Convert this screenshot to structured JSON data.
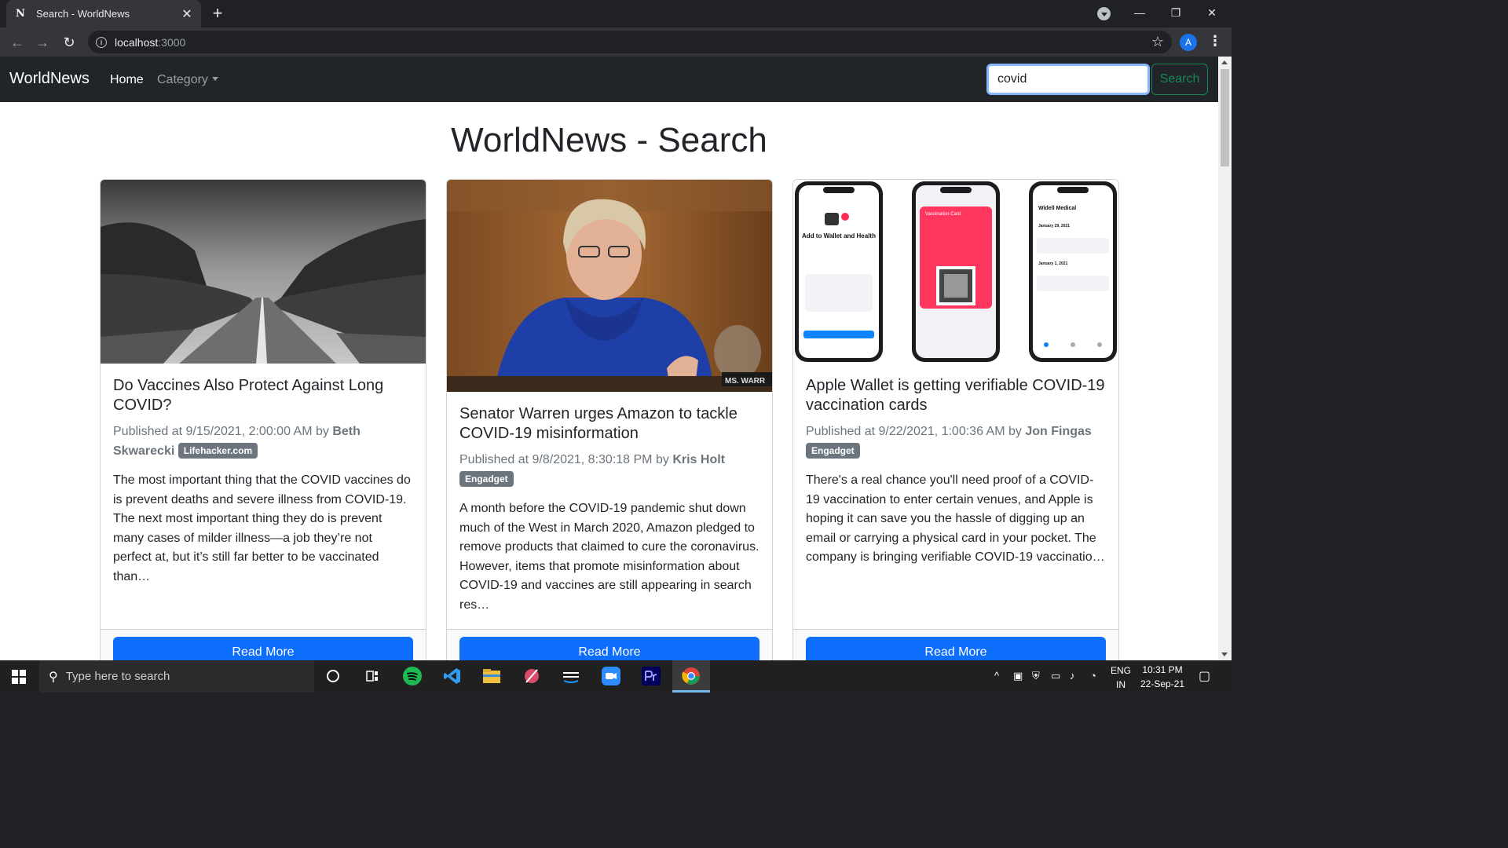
{
  "browser": {
    "tab_title": "Search - WorldNews",
    "favicon": "N",
    "url_host": "localhost",
    "url_port": ":3000",
    "profile_initial": "A"
  },
  "navbar": {
    "brand": "WorldNews",
    "home": "Home",
    "category": "Category",
    "search_value": "covid",
    "search_button": "Search"
  },
  "page_title": "WorldNews - Search",
  "articles": [
    {
      "title": "Do Vaccines Also Protect Against Long COVID?",
      "published_prefix": "Published at 9/15/2021, 2:00:00 AM by",
      "author": "Beth Skwarecki",
      "source": "Lifehacker.com",
      "description": "The most important thing that the COVID vaccines do is prevent deaths and severe illness from COVID-19. The next most important thing they do is prevent many cases of milder illness—a job they’re not perfect at, but it’s still far better to be vaccinated than…",
      "button": "Read More"
    },
    {
      "title": "Senator Warren urges Amazon to tackle COVID-19 misinformation",
      "published_prefix": "Published at 9/8/2021, 8:30:18 PM by",
      "author": "Kris Holt",
      "source": "Engadget",
      "description": "A month before the COVID-19 pandemic shut down much of the West in March 2020, Amazon pledged to remove products that claimed to cure the coronavirus. However, items that promote misinformation about COVID-19 and vaccines are still appearing in search res…",
      "button": "Read More",
      "image_caption": "MS. WARR"
    },
    {
      "title": "Apple Wallet is getting verifiable COVID-19 vaccination cards",
      "published_prefix": "Published at 9/22/2021, 1:00:36 AM by",
      "author": "Jon Fingas",
      "source": "Engadget",
      "description": "There's a real chance you'll need proof of a COVID-19 vaccination to enter certain venues, and Apple is hoping it can save you the hassle of digging up an email or carrying a physical card in your pocket. The company is bringing verifiable COVID-19 vaccinatio…",
      "button": "Read More",
      "phone1_title": "Add to Wallet and Health",
      "phone2_title": "Vaccination Card",
      "phone3_title": "Widell Medical",
      "phone3_date1": "January 29, 2021",
      "phone3_date2": "January 1, 2021"
    }
  ],
  "taskbar": {
    "search_placeholder": "Type here to search",
    "lang_top": "ENG",
    "lang_bottom": "IN",
    "time": "10:31 PM",
    "date": "22-Sep-21"
  },
  "colors": {
    "navbar_bg": "#212529",
    "primary": "#0d6efd",
    "success": "#198754",
    "badge": "#6c757d"
  }
}
